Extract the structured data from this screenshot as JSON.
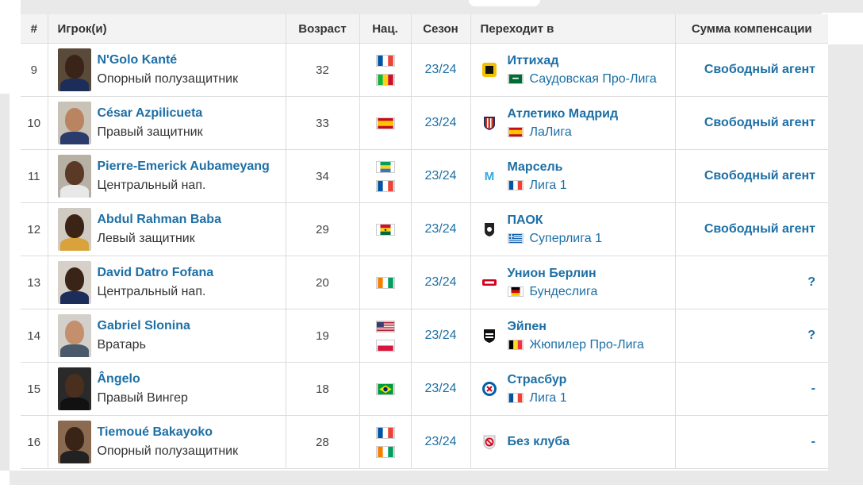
{
  "columns": {
    "num": "#",
    "player": "Игрок(и)",
    "age": "Возраст",
    "nat": "Нац.",
    "season": "Сезон",
    "to": "Переходит в",
    "fee": "Сумма компенсации"
  },
  "rows": [
    {
      "num": "9",
      "name": "N'Golo Kanté",
      "position": "Опорный полузащитник",
      "age": "32",
      "season": "23/24",
      "club": "Иттихад",
      "league": "Саудовская Про-Лига",
      "fee": "Свободный агент"
    },
    {
      "num": "10",
      "name": "César Azpilicueta",
      "position": "Правый защитник",
      "age": "33",
      "season": "23/24",
      "club": "Атлетико Мадрид",
      "league": "ЛаЛига",
      "fee": "Свободный агент"
    },
    {
      "num": "11",
      "name": "Pierre-Emerick Aubameyang",
      "position": "Центральный нап.",
      "age": "34",
      "season": "23/24",
      "club": "Марсель",
      "league": "Лига 1",
      "fee": "Свободный агент"
    },
    {
      "num": "12",
      "name": "Abdul Rahman Baba",
      "position": "Левый защитник",
      "age": "29",
      "season": "23/24",
      "club": "ПАОК",
      "league": "Суперлига 1",
      "fee": "Свободный агент"
    },
    {
      "num": "13",
      "name": "David Datro Fofana",
      "position": "Центральный нап.",
      "age": "20",
      "season": "23/24",
      "club": "Унион Берлин",
      "league": "Бундеслига",
      "fee": "?"
    },
    {
      "num": "14",
      "name": "Gabriel Slonina",
      "position": "Вратарь",
      "age": "19",
      "season": "23/24",
      "club": "Эйпен",
      "league": "Жюпилер Про-Лига",
      "fee": "?"
    },
    {
      "num": "15",
      "name": "Ângelo",
      "position": "Правый Вингер",
      "age": "18",
      "season": "23/24",
      "club": "Страсбур",
      "league": "Лига 1",
      "fee": "-"
    },
    {
      "num": "16",
      "name": "Tiemoué Bakayoko",
      "position": "Опорный полузащитник",
      "age": "28",
      "season": "23/24",
      "club": "Без клуба",
      "league": "",
      "fee": "-"
    }
  ],
  "colors": {
    "link": "#1d6fa5",
    "header_bg": "#f3f3f3",
    "border": "#dcdcdc"
  }
}
